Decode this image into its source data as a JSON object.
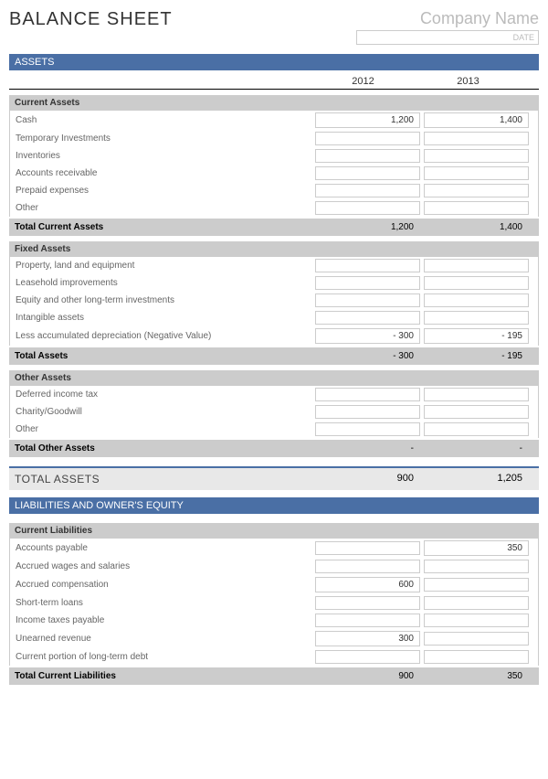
{
  "title": "BALANCE SHEET",
  "company_name": "Company Name",
  "date_placeholder": "DATE",
  "years": {
    "y1": "2012",
    "y2": "2013"
  },
  "assets": {
    "header": "ASSETS",
    "current": {
      "title": "Current Assets",
      "rows": [
        {
          "label": "Cash",
          "v1": "1,200",
          "v2": "1,400"
        },
        {
          "label": "Temporary Investments",
          "v1": "",
          "v2": ""
        },
        {
          "label": "Inventories",
          "v1": "",
          "v2": ""
        },
        {
          "label": "Accounts receivable",
          "v1": "",
          "v2": ""
        },
        {
          "label": "Prepaid expenses",
          "v1": "",
          "v2": ""
        },
        {
          "label": "Other",
          "v1": "",
          "v2": ""
        }
      ],
      "total_label": "Total Current Assets",
      "total_v1": "1,200",
      "total_v2": "1,400"
    },
    "fixed": {
      "title": "Fixed Assets",
      "rows": [
        {
          "label": "Property, land and equipment",
          "v1": "",
          "v2": ""
        },
        {
          "label": "Leasehold improvements",
          "v1": "",
          "v2": ""
        },
        {
          "label": "Equity and other long-term investments",
          "v1": "",
          "v2": ""
        },
        {
          "label": "Intangible assets",
          "v1": "",
          "v2": ""
        },
        {
          "label": "Less accumulated depreciation (Negative Value)",
          "v1": "- 300",
          "v2": "- 195"
        }
      ],
      "total_label": "Total Assets",
      "total_v1": "- 300",
      "total_v2": "- 195"
    },
    "other": {
      "title": "Other Assets",
      "rows": [
        {
          "label": "Deferred income tax",
          "v1": "",
          "v2": ""
        },
        {
          "label": "Charity/Goodwill",
          "v1": "",
          "v2": ""
        },
        {
          "label": "Other",
          "v1": "",
          "v2": ""
        }
      ],
      "total_label": "Total Other Assets",
      "total_v1": "-",
      "total_v2": "-"
    },
    "grand_total_label": "TOTAL ASSETS",
    "grand_total_v1": "900",
    "grand_total_v2": "1,205"
  },
  "liabilities": {
    "header": "LIABILITIES AND OWNER'S EQUITY",
    "current": {
      "title": "Current Liabilities",
      "rows": [
        {
          "label": "Accounts payable",
          "v1": "",
          "v2": "350"
        },
        {
          "label": "Accrued wages and salaries",
          "v1": "",
          "v2": ""
        },
        {
          "label": "Accrued compensation",
          "v1": "600",
          "v2": ""
        },
        {
          "label": "Short-term loans",
          "v1": "",
          "v2": ""
        },
        {
          "label": "Income taxes payable",
          "v1": "",
          "v2": ""
        },
        {
          "label": "Unearned revenue",
          "v1": "300",
          "v2": ""
        },
        {
          "label": "Current portion of long-term debt",
          "v1": "",
          "v2": ""
        }
      ],
      "total_label": "Total Current Liabilities",
      "total_v1": "900",
      "total_v2": "350"
    }
  }
}
